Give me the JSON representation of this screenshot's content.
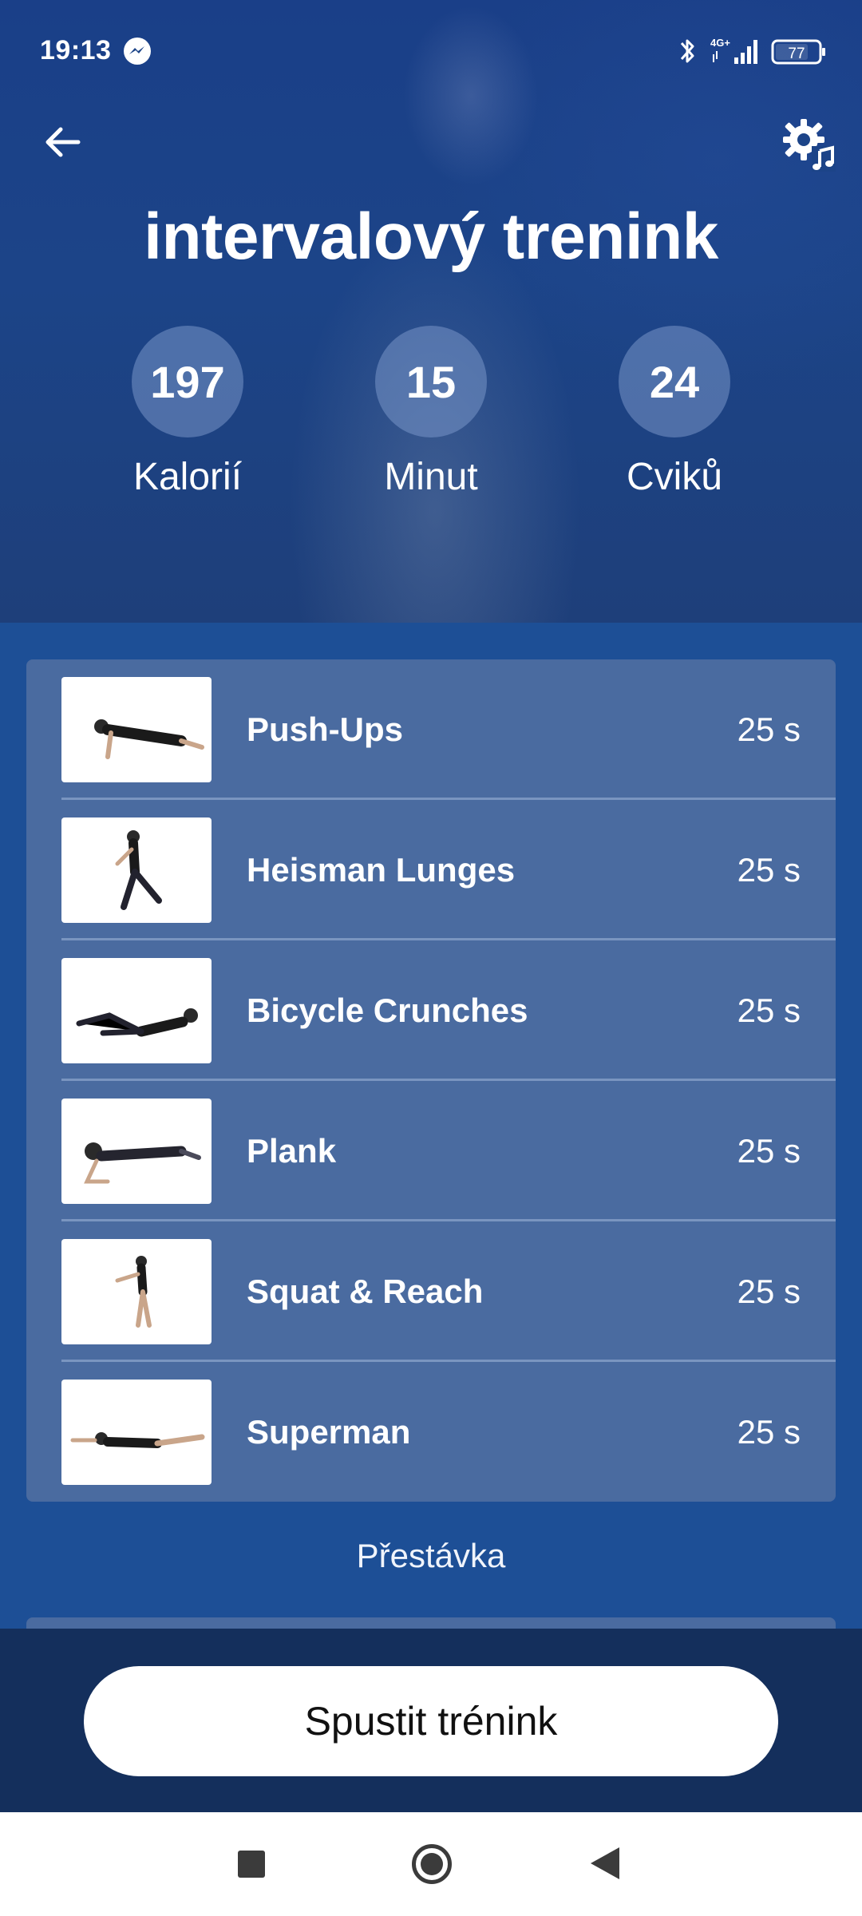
{
  "status_bar": {
    "time": "19:13",
    "network": "4G+",
    "battery": "77",
    "icons": [
      "messenger-icon",
      "bluetooth-icon",
      "signal-icon",
      "battery-icon"
    ]
  },
  "header": {
    "title": "intervalový trenink",
    "back_icon": "arrow-left-icon",
    "settings_icon": "gear-music-icon"
  },
  "stats": [
    {
      "value": "197",
      "label": "Kalorií"
    },
    {
      "value": "15",
      "label": "Minut"
    },
    {
      "value": "24",
      "label": "Cviků"
    }
  ],
  "exercises": [
    {
      "name": "Push-Ups",
      "duration": "25 s"
    },
    {
      "name": "Heisman Lunges",
      "duration": "25 s"
    },
    {
      "name": "Bicycle Crunches",
      "duration": "25 s"
    },
    {
      "name": "Plank",
      "duration": "25 s"
    },
    {
      "name": "Squat & Reach",
      "duration": "25 s"
    },
    {
      "name": "Superman",
      "duration": "25 s"
    }
  ],
  "pause_label": "Přestávka",
  "start_button": "Spustit trénink",
  "nav": {
    "icons": [
      "nav-recents-icon",
      "nav-home-icon",
      "nav-back-icon"
    ]
  },
  "colors": {
    "background": "#1d4f96",
    "card": "#4a6ba0",
    "bottom_bar": "#142f5c",
    "button": "#ffffff"
  }
}
